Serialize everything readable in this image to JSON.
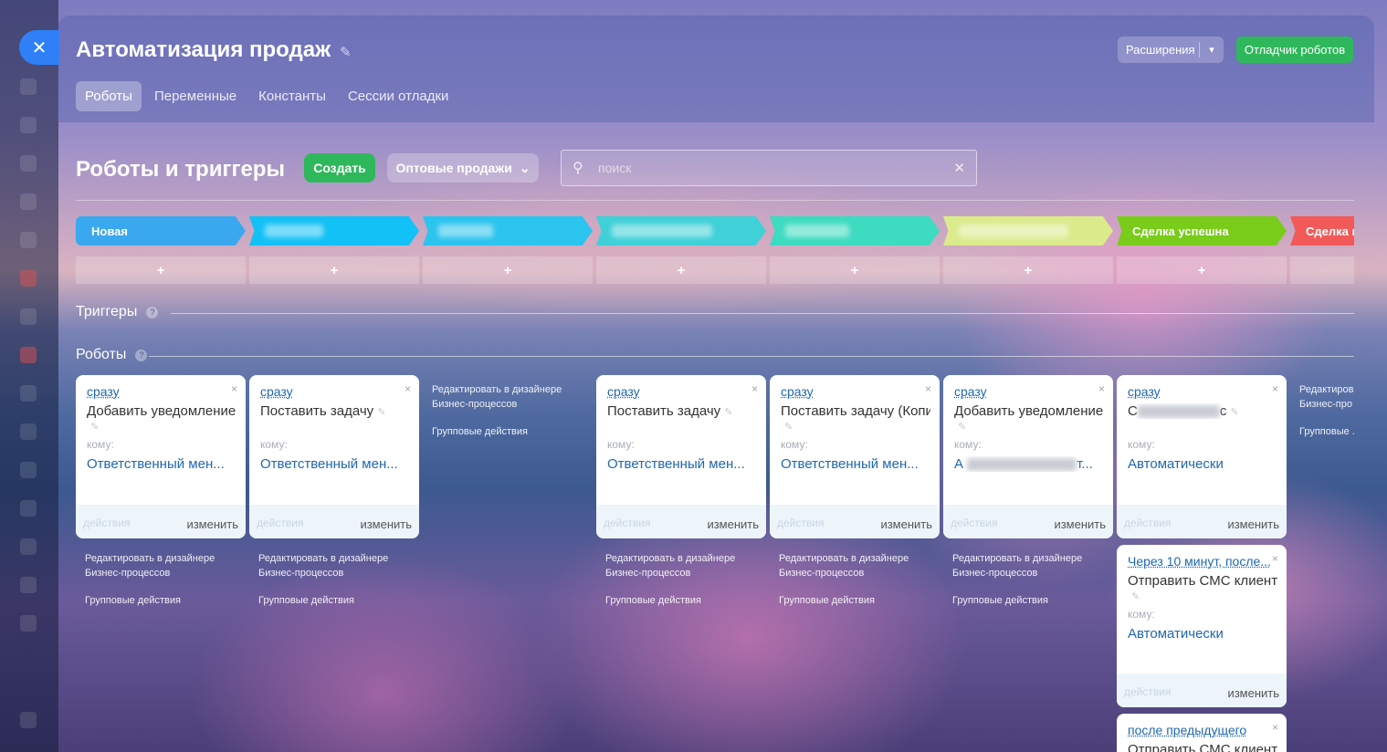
{
  "window": {
    "title": "Автоматизация продаж"
  },
  "header": {
    "extensions_label": "Расширения",
    "debugger_label": "Отладчик роботов",
    "tabs": [
      {
        "label": "Роботы",
        "active": true
      },
      {
        "label": "Переменные",
        "active": false
      },
      {
        "label": "Константы",
        "active": false
      },
      {
        "label": "Сессии отладки",
        "active": false
      }
    ]
  },
  "toolbar": {
    "section_title": "Роботы и триггеры",
    "create_label": "Создать",
    "funnel_label": "Оптовые продажи",
    "search_placeholder": "поиск"
  },
  "stages": [
    {
      "label": "Новая",
      "color": "#3aa8ee",
      "blurred": false
    },
    {
      "label": "",
      "color": "#12c1f5",
      "blurred": true
    },
    {
      "label": "",
      "color": "#2bc4ee",
      "blurred": true
    },
    {
      "label": "",
      "color": "#3fd0d8",
      "blurred": true
    },
    {
      "label": "",
      "color": "#3ddbc0",
      "blurred": true
    },
    {
      "label": "",
      "color": "#dbeb8c",
      "blurred": true
    },
    {
      "label": "Сделка успешна",
      "color": "#79cc1a",
      "blurred": false
    },
    {
      "label": "Сделка г",
      "color": "#f25a5a",
      "blurred": false
    }
  ],
  "add_symbol": "+",
  "triggers_label": "Триггеры",
  "robots_label": "Роботы",
  "card_common": {
    "to_label": "кому:",
    "actions_label": "действия",
    "change_label": "изменить",
    "close_symbol": "×"
  },
  "cards": [
    {
      "trigger": "сразу",
      "name": "Добавить уведомление",
      "to": "Ответственный мен..."
    },
    {
      "trigger": "сразу",
      "name": "Поставить задачу",
      "to": "Ответственный мен..."
    },
    {
      "trigger": "сразу",
      "name": "Поставить задачу",
      "to": "Ответственный мен..."
    },
    {
      "trigger": "сразу",
      "name": "Поставить задачу (Копия)",
      "to": "Ответственный мен..."
    },
    {
      "trigger": "сразу",
      "name": "Добавить уведомление",
      "to": "А",
      "to_suffix": "т..."
    },
    {
      "trigger": "сразу",
      "name": "С",
      "name_suffix": "с",
      "to": "Автоматически"
    },
    {
      "trigger": "Через 10 минут, после...",
      "name": "Отправить СМС клиенту",
      "to": "Автоматически"
    },
    {
      "trigger": "после предыдущего",
      "name": "Отправить СМС клиенту",
      "to": ""
    }
  ],
  "column_links": {
    "edit_designer": "Редактировать в дизайнере Бизнес-процессов",
    "group_actions": "Групповые действия",
    "edit_designer_cut": "Редактиров Бизнес-про",
    "group_actions_cut": "Групповые ."
  }
}
